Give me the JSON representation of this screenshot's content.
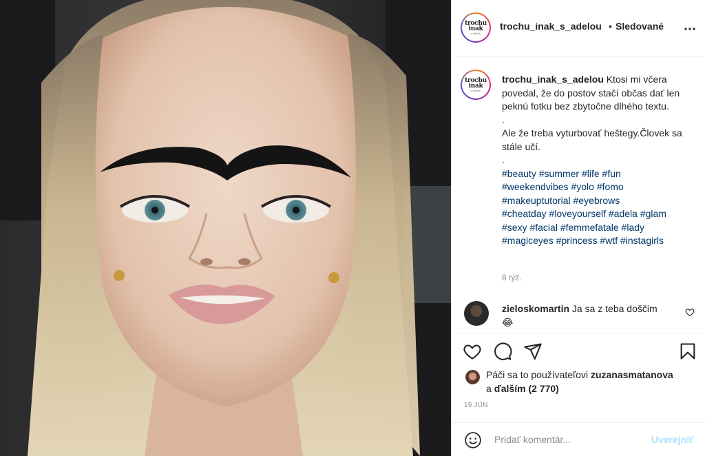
{
  "header": {
    "username": "trochu_inak_s_adelou",
    "separator": "•",
    "follow_status": "Sledované",
    "more_icon": "more-horizontal-icon"
  },
  "avatar_logo": {
    "line1": "trochu",
    "line2": "inak",
    "line3": "s Adelou"
  },
  "caption": {
    "username": "trochu_inak_s_adelou",
    "text_1": "Ktosi mi včera povedal, že do postov stačí občas dať len peknú fotku bez zbytočne dlhého textu.",
    "dot_1": ".",
    "text_2": "Ale že treba vyturbovať heštegy.Človek sa stále učí.",
    "dot_2": ".",
    "hashtags": [
      "#beauty",
      "#summer",
      "#life",
      "#fun",
      "#weekendvibes",
      "#yolo",
      "#fomo",
      "#makeuptutorial",
      "#eyebrows",
      "#cheatday",
      "#loveyourself",
      "#adela",
      "#glam",
      "#sexy",
      "#facial",
      "#femmefatale",
      "#lady",
      "#magiceyes",
      "#princess",
      "#wtf",
      "#instagirls"
    ],
    "time": "8 týž."
  },
  "comment": {
    "username": "zieloskomartin",
    "text": "Ja sa z teba doščim 😂"
  },
  "actions": {
    "like_icon": "heart-icon",
    "comment_icon": "comment-icon",
    "share_icon": "share-icon",
    "save_icon": "bookmark-icon"
  },
  "likes": {
    "prefix": "Páči sa to používateľovi",
    "user": "zuzanasmatanova",
    "and": "a",
    "others": "ďalším (2 770)"
  },
  "date": "19 JÚN",
  "add_comment": {
    "placeholder": "Pridať komentár...",
    "post_label": "Uverejniť"
  },
  "colors": {
    "link": "#00376b",
    "muted": "#8e8e8e",
    "post_disabled": "#b2dffc",
    "border": "#efefef"
  }
}
